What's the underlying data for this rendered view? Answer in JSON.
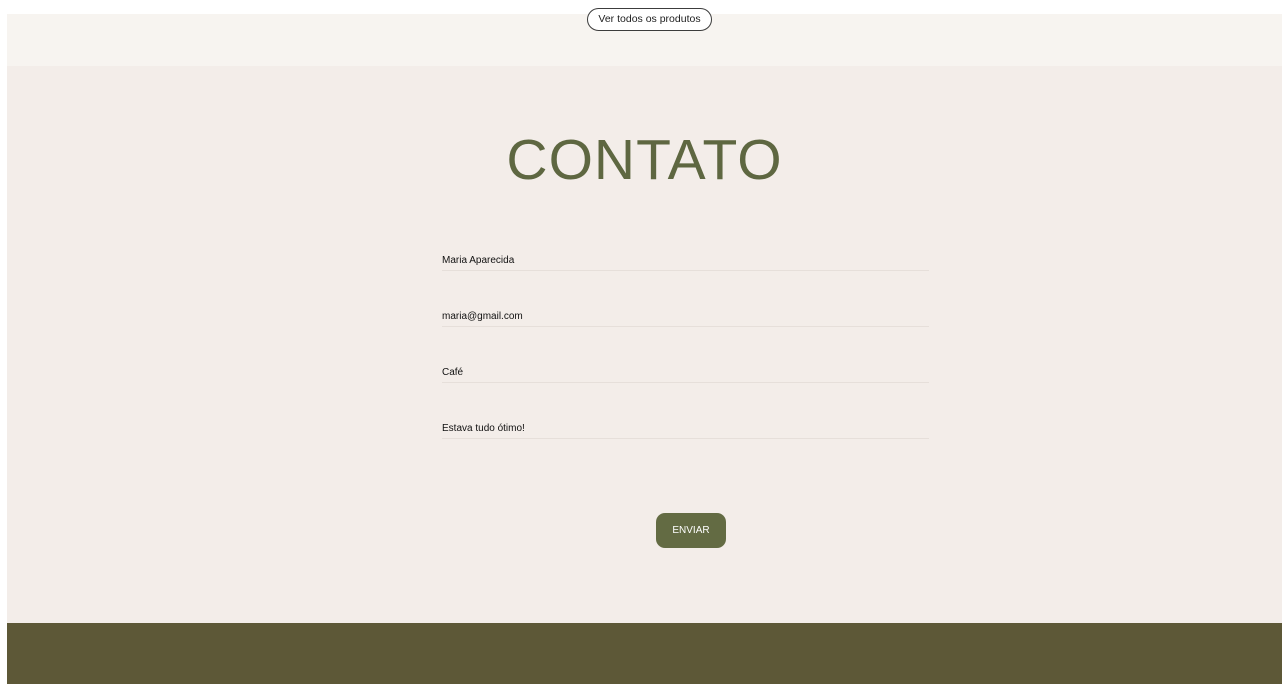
{
  "top": {
    "products_button_label": "Ver todos os produtos"
  },
  "contact": {
    "title": "CONTATO",
    "fields": {
      "name": "Maria Aparecida",
      "email": "maria@gmail.com",
      "subject": "Café",
      "message": "Estava tudo ótimo!"
    },
    "submit_label": "ENVIAR"
  },
  "colors": {
    "accent": "#636b43",
    "title": "#5e6741",
    "section_bg": "#f3ede9",
    "footer_bg": "#5d5837"
  }
}
